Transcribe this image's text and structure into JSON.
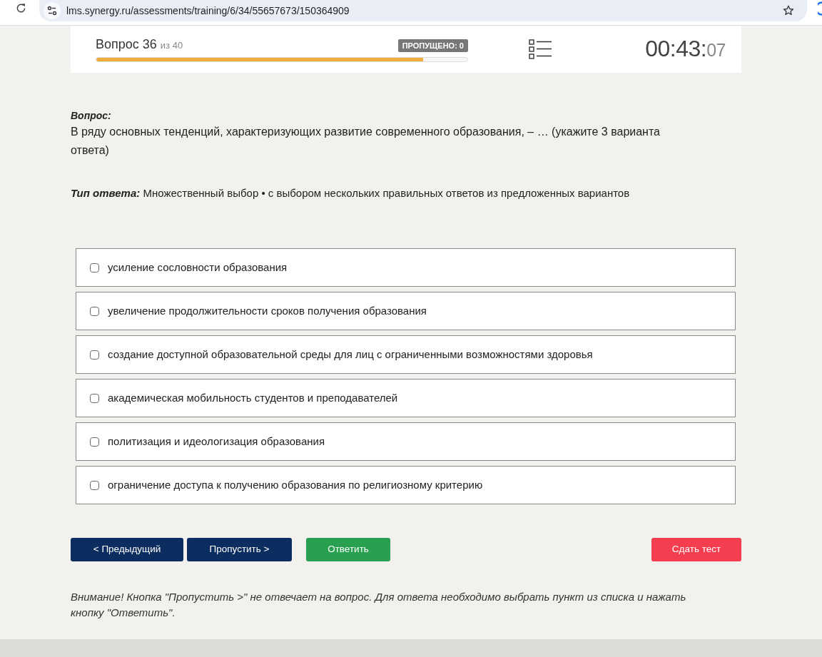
{
  "browser": {
    "url": "lms.synergy.ru/assessments/training/6/34/55657673/150364909"
  },
  "header": {
    "question_number": "Вопрос 36",
    "question_total": "из 40",
    "skipped_badge": "ПРОПУЩЕНО: 0",
    "progress": {
      "level": 0.88
    },
    "timer": {
      "main": "00:43:",
      "seconds": "07"
    }
  },
  "question": {
    "label": "Вопрос:",
    "text": "В ряду основных тенденций, характеризующих развитие современного образования, – … (укажите 3 варианта ответа)",
    "answer_type": "**Тип ответа:** Множественный выбор • с выбором нескольких правильных ответов из предложенных вариантов"
  },
  "options": [
    {
      "label": "усиление сословности образования",
      "checked": false
    },
    {
      "label": "увеличение продолжительности сроков получения образования",
      "checked": false
    },
    {
      "label": "создание доступной образовательной среды для лиц с ограниченными возможностями здоровья",
      "checked": false
    },
    {
      "label": "академическая мобильность студентов и преподавателей",
      "checked": false
    },
    {
      "label": "политизация и идеологизация образования",
      "checked": false
    },
    {
      "label": "ограничение доступа к получению образования по религиозному критерию",
      "checked": false
    }
  ],
  "buttons": [
    {
      "label": "< Предыдущий",
      "kind": "nav"
    },
    {
      "label": "Пропустить >",
      "kind": "nav"
    },
    {
      "label": "Ответить",
      "kind": "answer"
    },
    {
      "label": "Сдать тест",
      "kind": "submit"
    }
  ],
  "notice": "Внимание! Кнопка \"Пропустить >\" не отвечает на вопрос. Для ответа необходимо выбрать пункт из списка и нажать кнопку \"Ответить\"."
}
